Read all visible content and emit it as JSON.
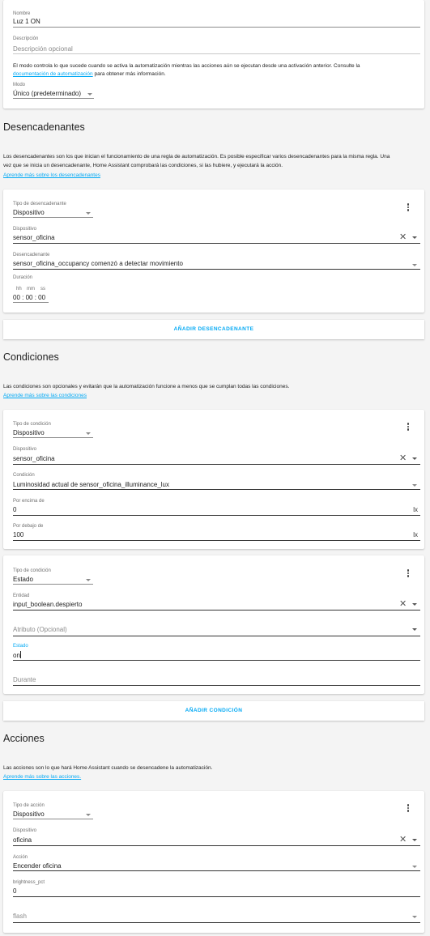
{
  "header_card": {
    "name_label": "Nombre",
    "name_value": "Luz 1 ON",
    "description_label": "Descripción",
    "description_placeholder": "Descripción opcional",
    "mode_text_before": "El modo controla lo que sucede cuando se activa la automatización mientras las acciones aún se ejecutan desde una activación anterior. Consulte la",
    "mode_doc_link": "documentación de automatización",
    "mode_text_after": "para obtener más información.",
    "mode_label": "Modo",
    "mode_value": "Único (predeterminado)"
  },
  "triggers": {
    "title": "Desencadenantes",
    "text_line1": "Los desencadenantes son los que inician el funcionamiento de una regla de automatización. Es posible especificar varios desencadenantes para la misma regla. Una",
    "text_line2": "vez que se inicia un desencadenante, Home Assistant comprobará las condiciones, si las hubiere, y ejecutará la acción.",
    "learn_link": "Aprende más sobre los desencadenantes",
    "card": {
      "type_label": "Tipo de desencadenante",
      "type_value": "Dispositivo",
      "device_label": "Dispositivo",
      "device_value": "sensor_oficina",
      "trigger_label": "Desencadenante",
      "trigger_value": "sensor_oficina_occupancy comenzó a detectar movimiento",
      "duration_label": "Duración",
      "hh": "hh",
      "mm": "mm",
      "ss": "ss",
      "duration_value": "00 : 00 : 00"
    },
    "add_button": "Añadir desencadenante"
  },
  "conditions": {
    "title": "Condiciones",
    "text": "Las condiciones son opcionales y evitarán que la automatización funcione a menos que se cumplan todas las condiciones.",
    "learn_link": "Aprende más sobre las condiciones",
    "card1": {
      "type_label": "Tipo de condición",
      "type_value": "Dispositivo",
      "device_label": "Dispositivo",
      "device_value": "sensor_oficina",
      "condition_label": "Condición",
      "condition_value": "Luminosidad actual de sensor_oficina_illuminance_lux",
      "above_label": "Por encima de",
      "above_value": "0",
      "above_unit": "lx",
      "below_label": "Por debajo de",
      "below_value": "100",
      "below_unit": "lx"
    },
    "card2": {
      "type_label": "Tipo de condición",
      "type_value": "Estado",
      "entity_label": "Entidad",
      "entity_value": "input_boolean.despierto",
      "attribute_placeholder": "Atributo (Opcional)",
      "state_label": "Estado",
      "state_value": "on",
      "for_placeholder": "Durante"
    },
    "add_button": "Añadir condición"
  },
  "actions": {
    "title": "Acciones",
    "text": "Las acciones son lo que hará Home Assistant cuando se desencadene la automatización.",
    "learn_link": "Aprende más sobre las acciones.",
    "card": {
      "type_label": "Tipo de acción",
      "type_value": "Dispositivo",
      "device_label": "Dispositivo",
      "device_value": "oficina",
      "action_label": "Acción",
      "action_value": "Encender oficina",
      "brightness_label": "brightness_pct",
      "brightness_value": "0",
      "flash_placeholder": "flash"
    }
  },
  "colors": {
    "accent": "#03a9f4",
    "background": "#f4f4f4",
    "card": "#ffffff",
    "text": "#212121"
  }
}
